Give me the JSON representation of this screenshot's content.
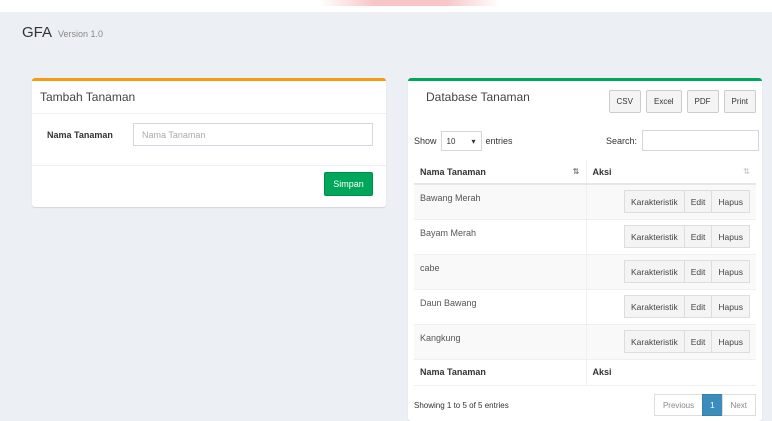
{
  "header": {
    "title": "GFA",
    "version": "Version 1.0"
  },
  "form_box": {
    "title": "Tambah Tanaman",
    "field_label": "Nama Tanaman",
    "field_placeholder": "Nama Tanaman",
    "field_value": "",
    "submit_label": "Simpan"
  },
  "table_box": {
    "title": "Database Tanaman",
    "export_buttons": [
      "CSV",
      "Excel",
      "PDF",
      "Print"
    ],
    "length": {
      "show_label": "Show",
      "selected": "10",
      "entries_label": "entries"
    },
    "search_label": "Search:",
    "columns": [
      "Nama Tanaman",
      "Aksi"
    ],
    "rows": [
      "Bawang Merah",
      "Bayam Merah",
      "cabe",
      "Daun Bawang",
      "Kangkung"
    ],
    "row_actions": [
      "Karakteristik",
      "Edit",
      "Hapus"
    ],
    "footer_columns": [
      "Nama Tanaman",
      "Aksi"
    ],
    "info": "Showing 1 to 5 of 5 entries",
    "pagination": {
      "previous": "Previous",
      "current": "1",
      "next": "Next"
    }
  },
  "colors": {
    "background": "#ecf0f5",
    "form_accent": "#f39c12",
    "table_accent": "#00a65a",
    "primary_button": "#00a65a",
    "active_page": "#3c8dbc"
  },
  "icons": {
    "sort_ascending": "sort-alpha-asc-icon",
    "sort_both": "sort-icon",
    "select_caret": "caret-down-icon"
  }
}
